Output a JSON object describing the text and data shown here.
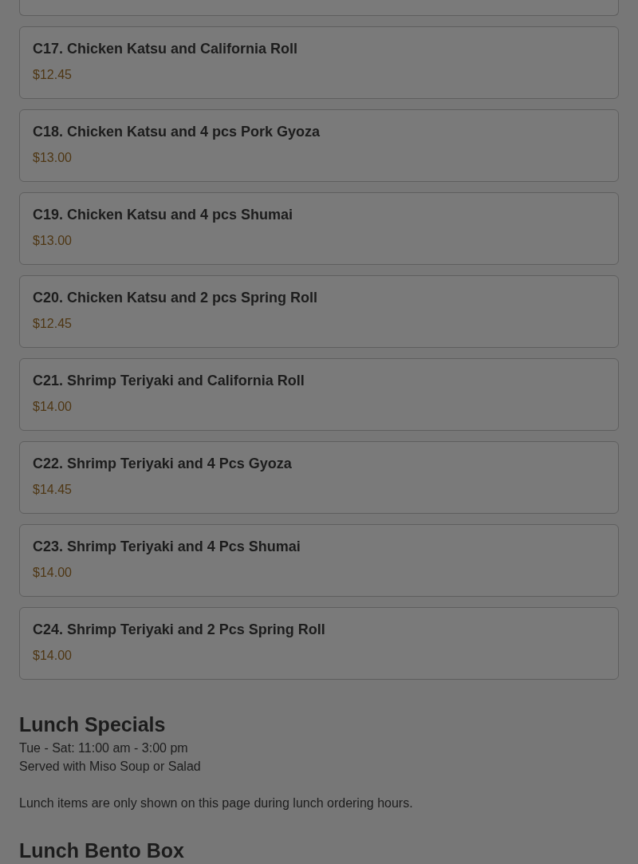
{
  "items": [
    {
      "name": "C17. Chicken Katsu and California Roll",
      "price": "$12.45"
    },
    {
      "name": "C18. Chicken Katsu and 4 pcs Pork Gyoza",
      "price": "$13.00"
    },
    {
      "name": "C19. Chicken Katsu and 4 pcs Shumai",
      "price": "$13.00"
    },
    {
      "name": "C20. Chicken Katsu and 2 pcs Spring Roll",
      "price": "$12.45"
    },
    {
      "name": "C21. Shrimp Teriyaki and California Roll",
      "price": "$14.00"
    },
    {
      "name": "C22. Shrimp Teriyaki and 4 Pcs Gyoza",
      "price": "$14.45"
    },
    {
      "name": "C23. Shrimp Teriyaki and 4 Pcs Shumai",
      "price": "$14.00"
    },
    {
      "name": "C24. Shrimp Teriyaki and 2 Pcs Spring Roll",
      "price": "$14.00"
    }
  ],
  "section": {
    "title": "Lunch Specials",
    "hours": "Tue - Sat: 11:00 am - 3:00 pm",
    "served": "Served with Miso Soup or Salad",
    "note": "Lunch items are only shown on this page during lunch ordering hours."
  },
  "next_section": {
    "title": "Lunch Bento Box"
  }
}
